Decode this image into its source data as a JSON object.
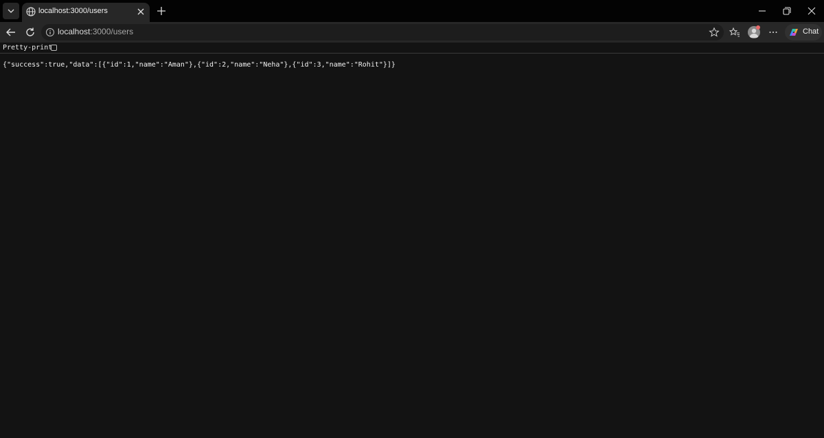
{
  "browser": {
    "tab": {
      "title": "localhost:3000/users",
      "favicon": "globe-icon"
    },
    "window_controls": [
      "minimize-icon",
      "restore-icon",
      "close-icon"
    ]
  },
  "toolbar": {
    "url_host": "localhost",
    "url_path": ":3000/users",
    "chat_label": "Chat"
  },
  "page": {
    "pretty_print_label": "Pretty-print",
    "pretty_print_checked": false,
    "json_text": "{\"success\":true,\"data\":[{\"id\":1,\"name\":\"Aman\"},{\"id\":2,\"name\":\"Neha\"},{\"id\":3,\"name\":\"Rohit\"}]}"
  },
  "colors": {
    "titlebar": "#030303",
    "toolbar": "#272727",
    "page_background": "#131313",
    "text": "#f2f2f2"
  }
}
